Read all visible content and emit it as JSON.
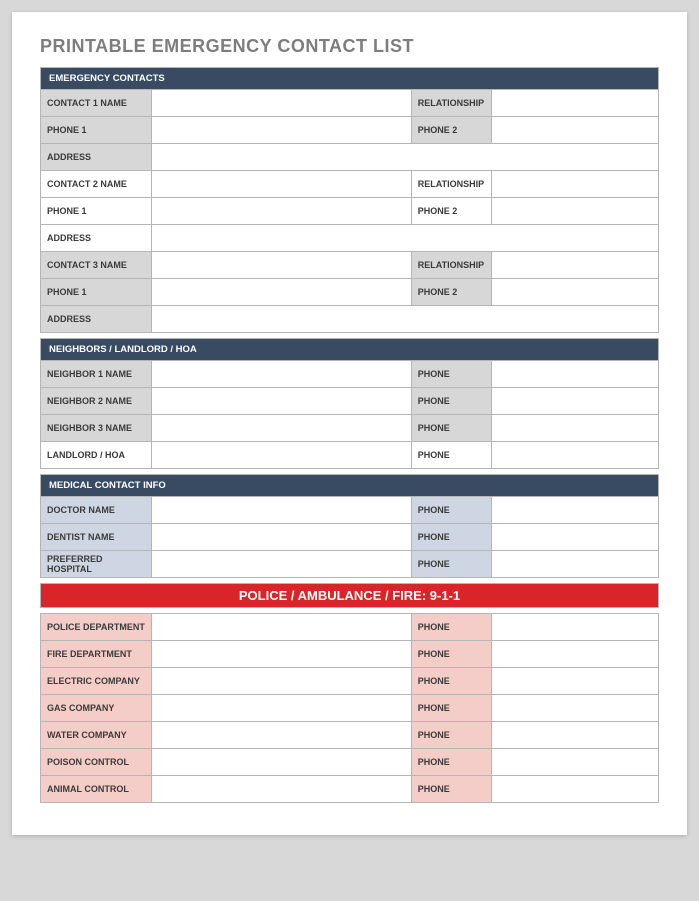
{
  "title": "PRINTABLE EMERGENCY CONTACT LIST",
  "sections": {
    "emergency": {
      "header": "EMERGENCY CONTACTS",
      "contacts": [
        {
          "name_label": "CONTACT 1 NAME",
          "rel_label": "RELATIONSHIP",
          "phone1_label": "PHONE 1",
          "phone2_label": "PHONE 2",
          "address_label": "ADDRESS"
        },
        {
          "name_label": "CONTACT 2 NAME",
          "rel_label": "RELATIONSHIP",
          "phone1_label": "PHONE 1",
          "phone2_label": "PHONE 2",
          "address_label": "ADDRESS"
        },
        {
          "name_label": "CONTACT 3 NAME",
          "rel_label": "RELATIONSHIP",
          "phone1_label": "PHONE 1",
          "phone2_label": "PHONE 2",
          "address_label": "ADDRESS"
        }
      ]
    },
    "neighbors": {
      "header": "NEIGHBORS / LANDLORD / HOA",
      "rows": [
        {
          "label": "NEIGHBOR 1 NAME",
          "phone_label": "PHONE"
        },
        {
          "label": "NEIGHBOR 2 NAME",
          "phone_label": "PHONE"
        },
        {
          "label": "NEIGHBOR 3 NAME",
          "phone_label": "PHONE"
        },
        {
          "label": "LANDLORD / HOA",
          "phone_label": "PHONE"
        }
      ]
    },
    "medical": {
      "header": "MEDICAL CONTACT INFO",
      "rows": [
        {
          "label": "DOCTOR NAME",
          "phone_label": "PHONE"
        },
        {
          "label": "DENTIST NAME",
          "phone_label": "PHONE"
        },
        {
          "label": "PREFERRED HOSPITAL",
          "phone_label": "PHONE"
        }
      ]
    },
    "emergency911": {
      "header": "POLICE / AMBULANCE / FIRE:  9-1-1",
      "rows": [
        {
          "label": "POLICE DEPARTMENT",
          "phone_label": "PHONE"
        },
        {
          "label": "FIRE DEPARTMENT",
          "phone_label": "PHONE"
        },
        {
          "label": "ELECTRIC COMPANY",
          "phone_label": "PHONE"
        },
        {
          "label": "GAS COMPANY",
          "phone_label": "PHONE"
        },
        {
          "label": "WATER COMPANY",
          "phone_label": "PHONE"
        },
        {
          "label": "POISON CONTROL",
          "phone_label": "PHONE"
        },
        {
          "label": "ANIMAL CONTROL",
          "phone_label": "PHONE"
        }
      ]
    }
  }
}
